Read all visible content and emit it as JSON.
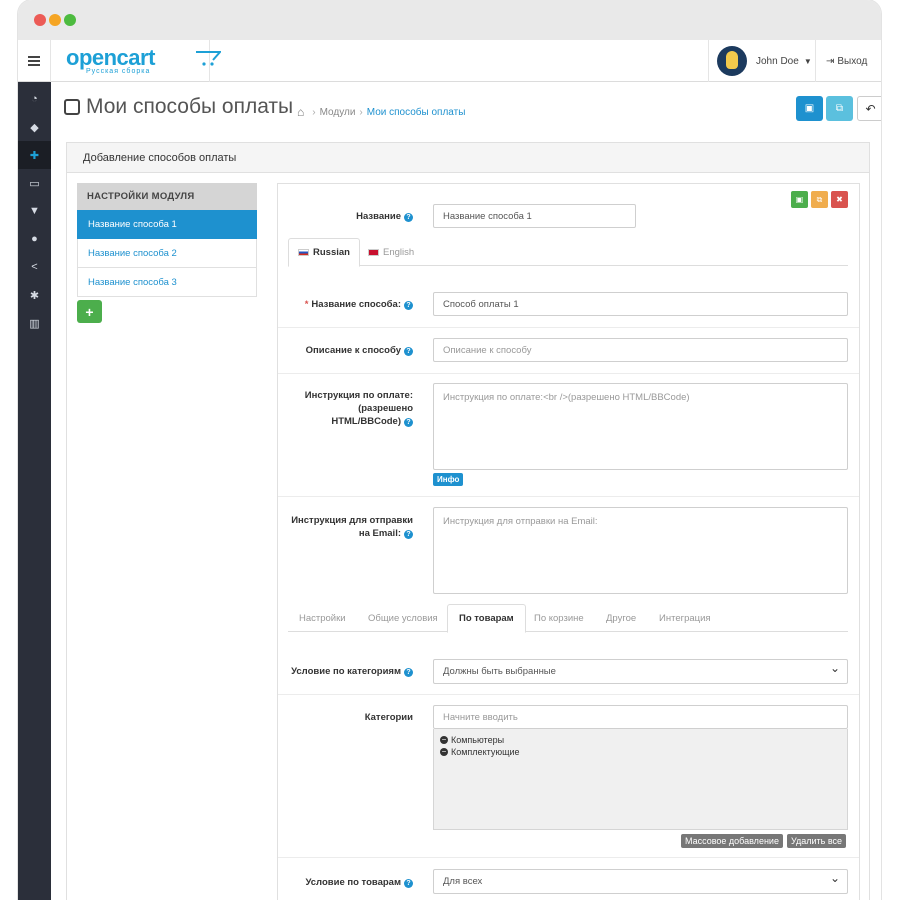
{
  "topbar": {
    "logo_main": "opencart",
    "logo_sub": "Русская сборка",
    "user_name": "John Doe",
    "logout_label": "Выход"
  },
  "sidebar": {
    "icons": [
      "dashboard-icon",
      "tag-icon",
      "puzzle-icon",
      "desktop-icon",
      "cart-icon",
      "user-icon",
      "share-icon",
      "cog-icon",
      "bar-chart-icon"
    ],
    "active_index": 2
  },
  "header": {
    "title": "Мои способы оплаты",
    "breadcrumb": [
      "Модули",
      "Мои способы оплаты"
    ]
  },
  "panel": {
    "heading": "Добавление способов оплаты"
  },
  "leftnav": {
    "heading": "НАСТРОЙКИ МОДУЛЯ",
    "items": [
      "Название способа 1",
      "Название способа 2",
      "Название способа 3"
    ],
    "add_label": "+"
  },
  "form": {
    "name_label": "Название",
    "name_value": "Название способа 1",
    "lang_tabs": [
      "Russian",
      "English"
    ],
    "method_name_label": "Название способа:",
    "method_name_value": "Способ оплаты 1",
    "desc_label": "Описание к способу",
    "desc_placeholder": "Описание к способу",
    "instr_label_1": "Инструкция по оплате:",
    "instr_label_2": "(разрешено",
    "instr_label_3": "HTML/BBCode)",
    "instr_placeholder": "Инструкция по оплате:<br />(разрешено HTML/BBCode)",
    "info_badge": "Инфо",
    "email_label_1": "Инструкция для отправки",
    "email_label_2": "на Email:",
    "email_placeholder": "Инструкция для отправки на Email:",
    "settings_tabs": [
      "Настройки",
      "Общие условия",
      "По товарам",
      "По корзине",
      "Другое",
      "Интеграция"
    ],
    "active_settings_tab": "По товарам",
    "cat_cond_label": "Условие по категориям",
    "cat_cond_value": "Должны быть выбранные",
    "categories_label": "Категории",
    "categories_placeholder": "Начните вводить",
    "categories_selected": [
      "Компьютеры",
      "Комплектующие"
    ],
    "bulk_add_label": "Массовое добавление",
    "delete_all_label": "Удалить все",
    "product_cond_label": "Условие по товарам",
    "product_cond_value": "Для всех"
  },
  "colors": {
    "primary": "#1e91cf",
    "success": "#4cae4c",
    "warning": "#f0ad4e",
    "danger": "#d9534f",
    "sidebar_bg": "#2b2f3a"
  }
}
